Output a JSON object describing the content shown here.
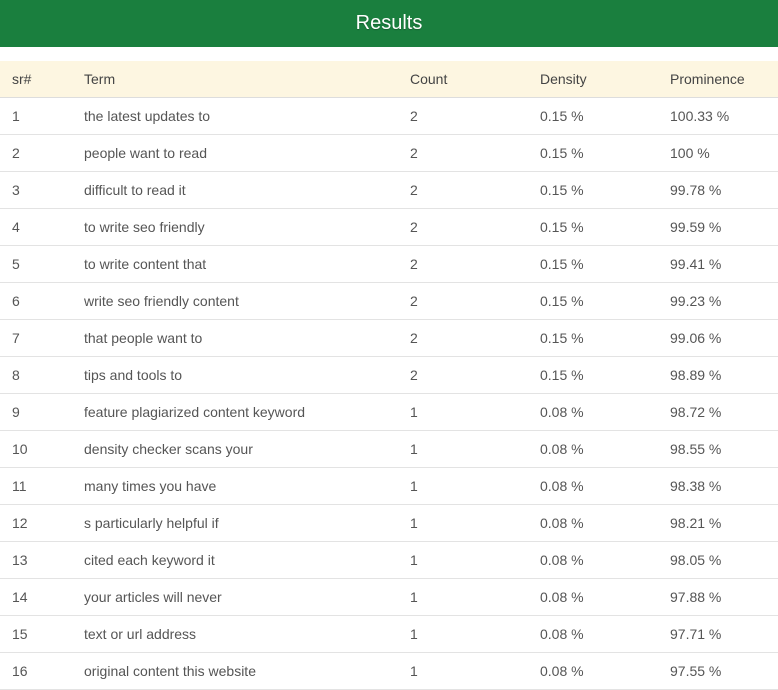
{
  "header": {
    "title": "Results"
  },
  "table": {
    "columns": {
      "sr": "sr#",
      "term": "Term",
      "count": "Count",
      "density": "Density",
      "prominence": "Prominence"
    },
    "rows": [
      {
        "sr": "1",
        "term": "the latest updates to",
        "count": "2",
        "density": "0.15 %",
        "prominence": "100.33 %"
      },
      {
        "sr": "2",
        "term": "people want to read",
        "count": "2",
        "density": "0.15 %",
        "prominence": "100 %"
      },
      {
        "sr": "3",
        "term": "difficult to read it",
        "count": "2",
        "density": "0.15 %",
        "prominence": "99.78 %"
      },
      {
        "sr": "4",
        "term": "to write seo friendly",
        "count": "2",
        "density": "0.15 %",
        "prominence": "99.59 %"
      },
      {
        "sr": "5",
        "term": "to write content that",
        "count": "2",
        "density": "0.15 %",
        "prominence": "99.41 %"
      },
      {
        "sr": "6",
        "term": "write seo friendly content",
        "count": "2",
        "density": "0.15 %",
        "prominence": "99.23 %"
      },
      {
        "sr": "7",
        "term": "that people want to",
        "count": "2",
        "density": "0.15 %",
        "prominence": "99.06 %"
      },
      {
        "sr": "8",
        "term": "tips and tools to",
        "count": "2",
        "density": "0.15 %",
        "prominence": "98.89 %"
      },
      {
        "sr": "9",
        "term": "feature plagiarized content keyword",
        "count": "1",
        "density": "0.08 %",
        "prominence": "98.72 %"
      },
      {
        "sr": "10",
        "term": "density checker scans your",
        "count": "1",
        "density": "0.08 %",
        "prominence": "98.55 %"
      },
      {
        "sr": "11",
        "term": "many times you have",
        "count": "1",
        "density": "0.08 %",
        "prominence": "98.38 %"
      },
      {
        "sr": "12",
        "term": "s particularly helpful if",
        "count": "1",
        "density": "0.08 %",
        "prominence": "98.21 %"
      },
      {
        "sr": "13",
        "term": "cited each keyword it",
        "count": "1",
        "density": "0.08 %",
        "prominence": "98.05 %"
      },
      {
        "sr": "14",
        "term": "your articles will never",
        "count": "1",
        "density": "0.08 %",
        "prominence": "97.88 %"
      },
      {
        "sr": "15",
        "term": "text or url address",
        "count": "1",
        "density": "0.08 %",
        "prominence": "97.71 %"
      },
      {
        "sr": "16",
        "term": "original content this website",
        "count": "1",
        "density": "0.08 %",
        "prominence": "97.55 %"
      }
    ]
  }
}
